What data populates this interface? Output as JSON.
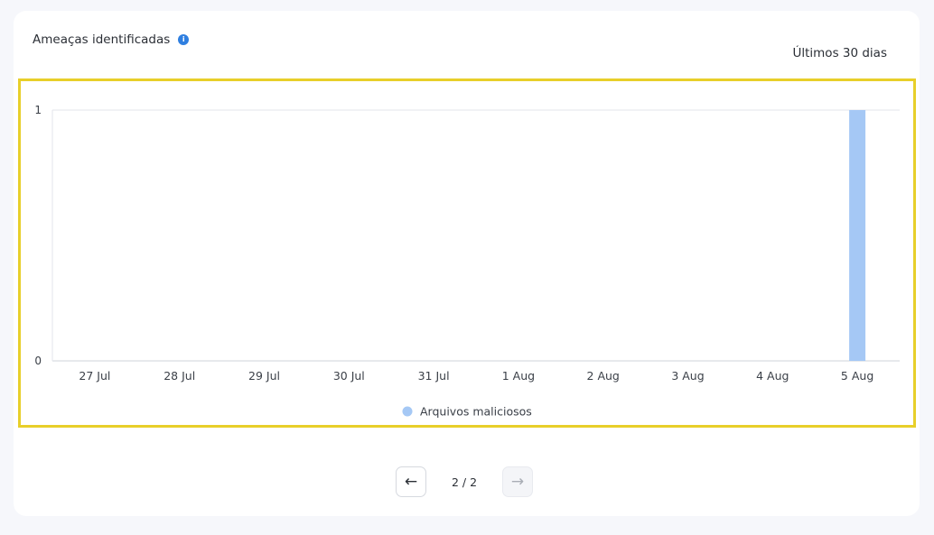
{
  "widget": {
    "title": "Ameaças identificadas",
    "time_range": "Últimos 30 dias",
    "info_icon": "info-icon",
    "highlight_color": "#e8cf2a"
  },
  "pagination": {
    "prev_icon": "arrow-left-icon",
    "next_icon": "arrow-right-icon",
    "page_info": "2 / 2"
  },
  "chart_data": {
    "type": "bar",
    "categories": [
      "27 Jul",
      "28 Jul",
      "29 Jul",
      "30 Jul",
      "31 Jul",
      "1 Aug",
      "2 Aug",
      "3 Aug",
      "4 Aug",
      "5 Aug"
    ],
    "series": [
      {
        "name": "Arquivos maliciosos",
        "values": [
          0,
          0,
          0,
          0,
          0,
          0,
          0,
          0,
          0,
          1
        ],
        "color": "#a5c8f5"
      }
    ],
    "ylim": [
      0,
      1
    ],
    "yticks": [
      0,
      1
    ],
    "title": "",
    "xlabel": "",
    "ylabel": "",
    "grid": true,
    "legend_position": "bottom-center"
  }
}
